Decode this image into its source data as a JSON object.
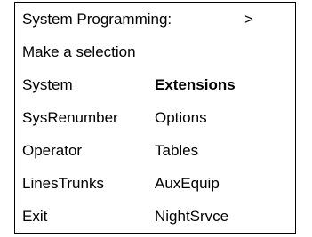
{
  "display": {
    "title": "System Programming:",
    "title_arrow": ">",
    "prompt": "Make a selection",
    "menu": {
      "left": [
        "System",
        "SysRenumber",
        "Operator",
        "LinesTrunks",
        "Exit"
      ],
      "right": [
        "Extensions",
        "Options",
        "Tables",
        "AuxEquip",
        "NightSrvce"
      ],
      "highlighted": "Extensions"
    }
  }
}
